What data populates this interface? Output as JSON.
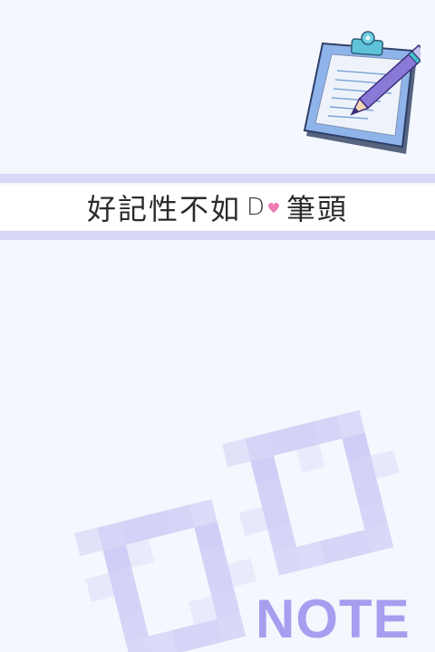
{
  "banner": {
    "title_prefix": "好記性不如",
    "do_text": "D",
    "title_suffix": "筆頭"
  },
  "watermark": {
    "label": "NOTE"
  },
  "icons": {
    "clipboard": "clipboard-with-pencil-icon",
    "heart": "heart-icon"
  },
  "colors": {
    "background": "#f4f7fd",
    "stripe": "#d6d8f6",
    "accent": "#a79ef0",
    "heart": "#f07ab4"
  }
}
